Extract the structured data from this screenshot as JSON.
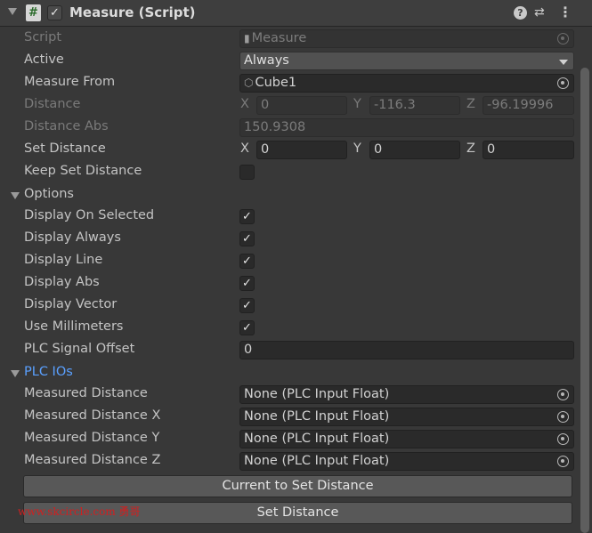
{
  "header": {
    "title": "Measure (Script)",
    "script_icon_glyph": "#",
    "enabled_check": "✓",
    "help_glyph": "?",
    "presets_glyph": "⇄",
    "menu_glyph": "⋮"
  },
  "fields": {
    "script": {
      "label": "Script",
      "value": "Measure"
    },
    "active": {
      "label": "Active",
      "value": "Always"
    },
    "measure_from": {
      "label": "Measure From",
      "value": "Cube1"
    },
    "distance": {
      "label": "Distance",
      "x_label": "X",
      "x": "0",
      "y_label": "Y",
      "y": "-116.3",
      "z_label": "Z",
      "z": "-96.19996"
    },
    "distance_abs": {
      "label": "Distance Abs",
      "value": "150.9308"
    },
    "set_distance": {
      "label": "Set Distance",
      "x_label": "X",
      "x": "0",
      "y_label": "Y",
      "y": "0",
      "z_label": "Z",
      "z": "0"
    },
    "keep_set_distance": {
      "label": "Keep Set Distance",
      "checked": false
    }
  },
  "options": {
    "label": "Options",
    "check_glyph": "✓",
    "display_on_selected": "Display On Selected",
    "display_always": "Display Always",
    "display_line": "Display Line",
    "display_abs": "Display Abs",
    "display_vector": "Display Vector",
    "use_millimeters": "Use Millimeters",
    "plc_signal_offset": {
      "label": "PLC Signal Offset",
      "value": "0"
    }
  },
  "plc_ios": {
    "label": "PLC IOs",
    "label_color": "#5aa0ff",
    "measured_distance": {
      "label": "Measured Distance",
      "value": "None (PLC Input Float)"
    },
    "measured_distance_x": {
      "label": "Measured Distance X",
      "value": "None (PLC Input Float)"
    },
    "measured_distance_y": {
      "label": "Measured Distance Y",
      "value": "None (PLC Input Float)"
    },
    "measured_distance_z": {
      "label": "Measured Distance Z",
      "value": "None (PLC Input Float)"
    }
  },
  "buttons": {
    "current_to_set": "Current to Set Distance",
    "set_distance": "Set Distance"
  },
  "watermark": "www.skcircle.com 勇哥"
}
